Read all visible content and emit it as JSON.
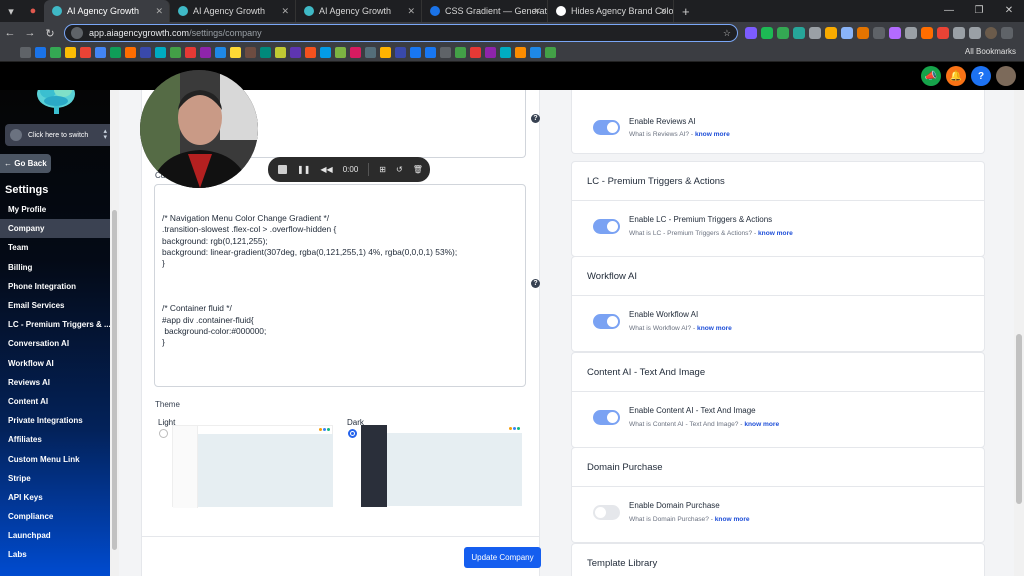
{
  "browser": {
    "tabs": [
      {
        "title": "AI Agency Growth",
        "fav": "#3fb9c6",
        "active": true
      },
      {
        "title": "AI Agency Growth",
        "fav": "#3fb9c6",
        "active": false
      },
      {
        "title": "AI Agency Growth",
        "fav": "#3fb9c6",
        "active": false
      },
      {
        "title": "CSS Gradient — Generator, Ma",
        "fav": "#1a73e8",
        "active": false
      },
      {
        "title": "Hides Agency Brand Colors - A",
        "fav": "#ffffff",
        "active": false
      }
    ],
    "url_host": "app.aiagencygrowth.com",
    "url_path": "/settings/company",
    "bookmarks_label": "All Bookmarks",
    "new_tab": "+"
  },
  "sidebar": {
    "switch_label": "Click here to switch",
    "go_back": "Go Back",
    "settings_title": "Settings",
    "items": [
      {
        "label": "My Profile",
        "active": false
      },
      {
        "label": "Company",
        "active": true
      },
      {
        "label": "Team",
        "active": false
      },
      {
        "label": "Billing",
        "active": false
      },
      {
        "label": "Phone Integration",
        "active": false
      },
      {
        "label": "Email Services",
        "active": false
      },
      {
        "label": "LC - Premium Triggers & ...",
        "active": false
      },
      {
        "label": "Conversation AI",
        "active": false
      },
      {
        "label": "Workflow AI",
        "active": false
      },
      {
        "label": "Reviews AI",
        "active": false
      },
      {
        "label": "Content AI",
        "active": false
      },
      {
        "label": "Private Integrations",
        "active": false
      },
      {
        "label": "Affiliates",
        "active": false
      },
      {
        "label": "Custom Menu Link",
        "active": false
      },
      {
        "label": "Stripe",
        "active": false
      },
      {
        "label": "API Keys",
        "active": false
      },
      {
        "label": "Compliance",
        "active": false
      },
      {
        "label": "Launchpad",
        "active": false
      },
      {
        "label": "Labs",
        "active": false
      }
    ]
  },
  "company": {
    "css_label": "Cu",
    "code_lines": [
      "/* Navigation Menu Color Change Gradient */",
      ".transition-slowest .flex-col > .overflow-hidden {",
      "background: rgb(0,121,255);",
      "background: linear-gradient(307deg, rgba(0,121,255,1) 4%, rgba(0,0,0,1) 53%);",
      "}",
      "",
      "",
      "",
      "/* Container fluid */",
      "#app div .container-fluid{",
      " background-color:#000000;",
      "}"
    ],
    "theme_label": "Theme",
    "theme_light": "Light",
    "theme_dark": "Dark",
    "update_button": "Update Company",
    "help": "?"
  },
  "recorder": {
    "time": "0:00"
  },
  "right_cards": [
    {
      "header": "",
      "title": "Enable Reviews AI",
      "sub": "What is Reviews AI? -",
      "link": "know more",
      "on": true
    },
    {
      "header": "LC - Premium Triggers & Actions",
      "title": "Enable LC - Premium Triggers & Actions",
      "sub": "What is LC - Premium Triggers & Actions? -",
      "link": "know more",
      "on": true
    },
    {
      "header": "Workflow AI",
      "title": "Enable Workflow AI",
      "sub": "What is Workflow AI? -",
      "link": "know more",
      "on": true
    },
    {
      "header": "Content AI - Text And Image",
      "title": "Enable Content AI - Text And Image",
      "sub": "What is Content AI - Text And Image? -",
      "link": "know more",
      "on": true
    },
    {
      "header": "Domain Purchase",
      "title": "Enable Domain Purchase",
      "sub": "What is Domain Purchase? -",
      "link": "know more",
      "on": false
    },
    {
      "header": "Template Library",
      "title": "",
      "sub": "",
      "link": "",
      "on": false
    }
  ],
  "colors": {
    "primary": "#155eef",
    "toggle_on": "#7aa2f3",
    "sidebar_active": "#3b4252",
    "header_bg": "#000000"
  }
}
